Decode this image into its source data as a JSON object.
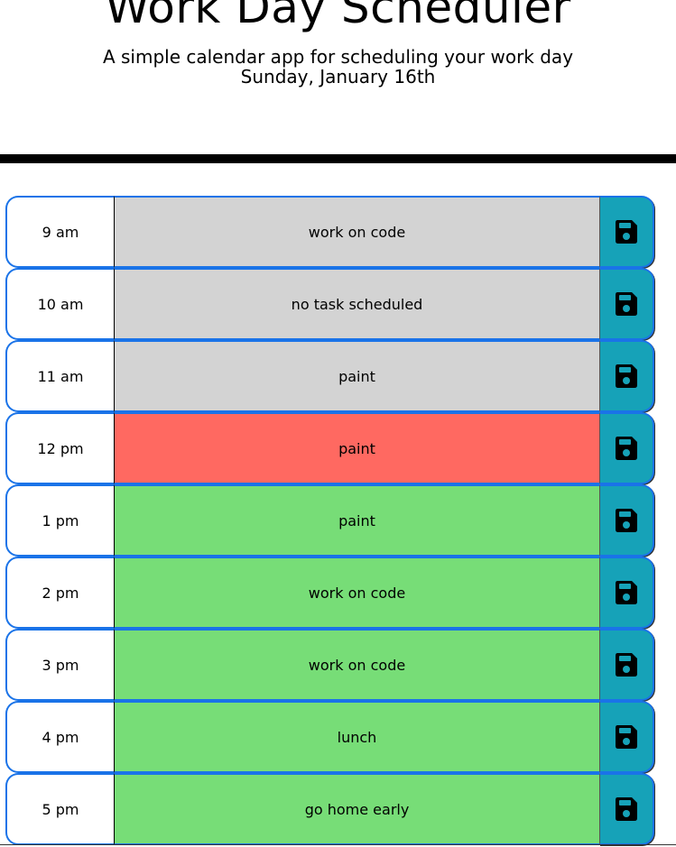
{
  "header": {
    "title": "Work Day Scheduler",
    "subtitle": "A simple calendar app for scheduling your work day",
    "current_day": "Sunday, January 16th"
  },
  "colors": {
    "past": "#d3d3d3",
    "present": "#ff6961",
    "future": "#77dd77",
    "save_button": "#16a2b8",
    "row_border": "#1a73e8"
  },
  "save_icon": "floppy-disk-icon",
  "timeblocks": [
    {
      "hour": "9 am",
      "task": "work on code",
      "status": "past"
    },
    {
      "hour": "10 am",
      "task": "no task scheduled",
      "status": "past"
    },
    {
      "hour": "11 am",
      "task": "paint",
      "status": "past"
    },
    {
      "hour": "12 pm",
      "task": "paint",
      "status": "present"
    },
    {
      "hour": "1 pm",
      "task": "paint",
      "status": "future"
    },
    {
      "hour": "2 pm",
      "task": "work on code",
      "status": "future"
    },
    {
      "hour": "3 pm",
      "task": "work on code",
      "status": "future"
    },
    {
      "hour": "4 pm",
      "task": "lunch",
      "status": "future"
    },
    {
      "hour": "5 pm",
      "task": "go home early",
      "status": "future"
    }
  ]
}
